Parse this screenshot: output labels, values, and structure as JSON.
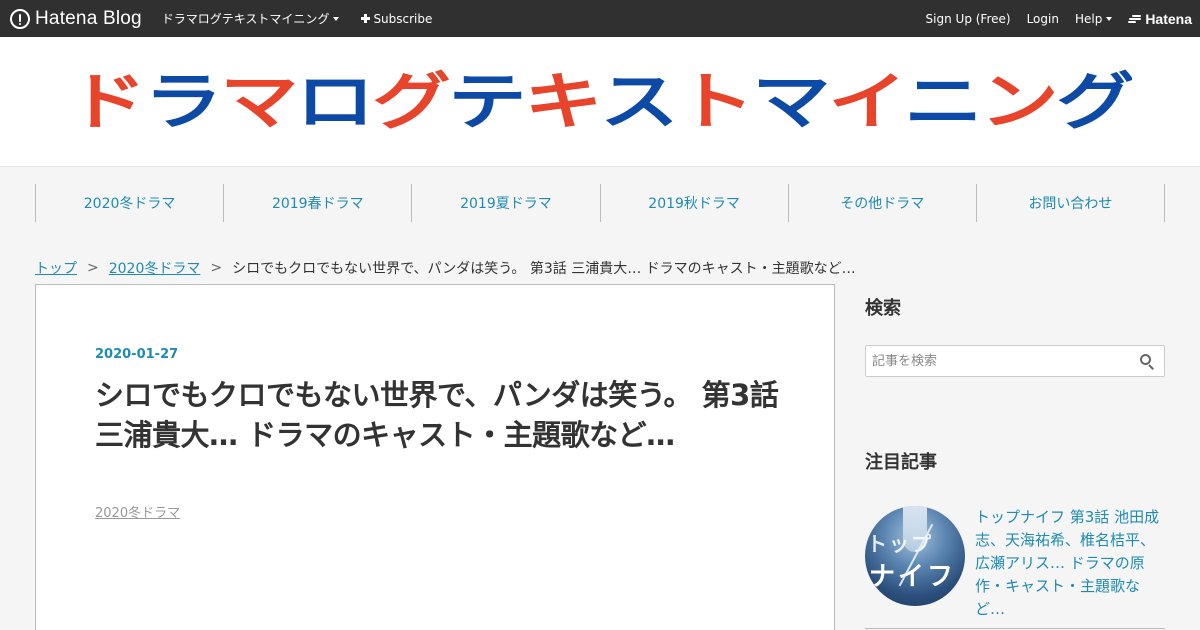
{
  "topbar": {
    "logo_text": "Hatena Blog",
    "blog_name": "ドラマログテキストマイニング",
    "subscribe_label": "Subscribe",
    "signup_label": "Sign Up (Free)",
    "login_label": "Login",
    "help_label": "Help",
    "hatena_label": "Hatena"
  },
  "header": {
    "blog_title_chars": [
      {
        "char": "ド",
        "color": "#e8432b"
      },
      {
        "char": "ラ",
        "color": "#0c4aa6"
      },
      {
        "char": "マ",
        "color": "#e8432b"
      },
      {
        "char": "ロ",
        "color": "#0c4aa6"
      },
      {
        "char": "グ",
        "color": "#e8432b"
      },
      {
        "char": "テ",
        "color": "#0c4aa6"
      },
      {
        "char": "キ",
        "color": "#e8432b"
      },
      {
        "char": "ス",
        "color": "#0c4aa6"
      },
      {
        "char": "ト",
        "color": "#e8432b"
      },
      {
        "char": "マ",
        "color": "#0c4aa6"
      },
      {
        "char": "イ",
        "color": "#e8432b"
      },
      {
        "char": "ニ",
        "color": "#0c4aa6"
      },
      {
        "char": "ン",
        "color": "#e8432b"
      },
      {
        "char": "グ",
        "color": "#0c4aa6"
      }
    ]
  },
  "nav": {
    "items": [
      "2020冬ドラマ",
      "2019春ドラマ",
      "2019夏ドラマ",
      "2019秋ドラマ",
      "その他ドラマ",
      "お問い合わせ"
    ]
  },
  "breadcrumb": {
    "top": "トップ",
    "separator": ">",
    "category": "2020冬ドラマ",
    "current": "シロでもクロでもない世界で、パンダは笑う。 第3話 三浦貴大… ドラマのキャスト・主題歌など…"
  },
  "article": {
    "date": "2020-01-27",
    "title": "シロでもクロでもない世界で、パンダは笑う。 第3話 三浦貴大… ドラマのキャスト・主題歌など…",
    "category": "2020冬ドラマ"
  },
  "sidebar": {
    "search_heading": "検索",
    "search_placeholder": "記事を検索",
    "featured_heading": "注目記事",
    "featured_title": "トップナイフ 第3話 池田成志、天海祐希、椎名桔平、広瀬アリス… ドラマの原作・キャスト・主題歌など…",
    "thumb_text_top": "トップ",
    "thumb_text_bottom": "ナイフ"
  },
  "colors": {
    "accent": "#1f8bb3",
    "topbar_bg": "#303030",
    "title_red": "#e8432b",
    "title_blue": "#0c4aa6"
  }
}
